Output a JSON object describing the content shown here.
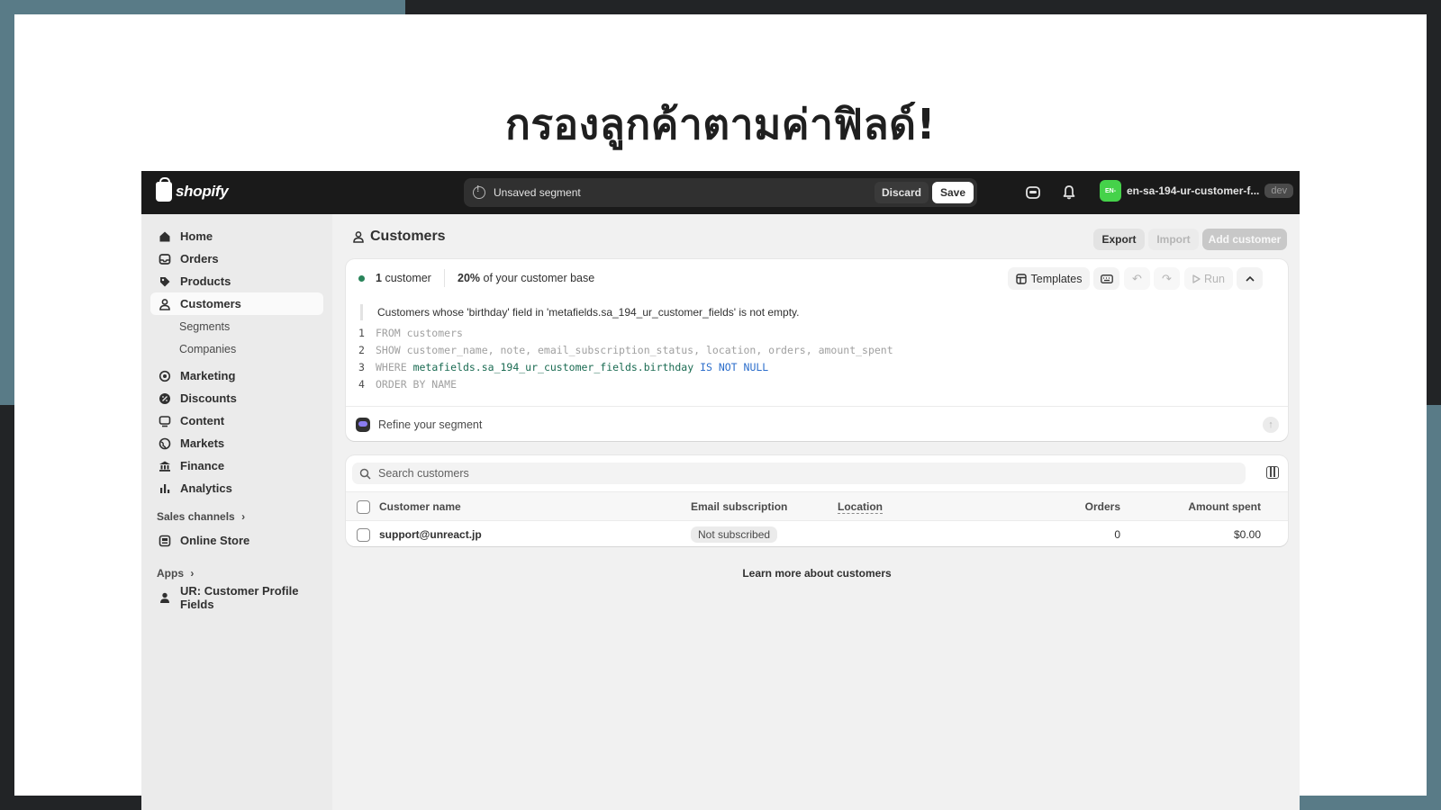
{
  "slide": {
    "title": "กรองลูกค้าตามค่าฟิลด์!"
  },
  "colors": {
    "accent_green": "#29845a",
    "store_avatar": "#45d24a",
    "topbar": "#1a1a1a"
  },
  "topbar": {
    "logo_text": "shopify",
    "unsaved_text": "Unsaved segment",
    "discard_label": "Discard",
    "save_label": "Save",
    "store_avatar_text": "EN-",
    "store_name": "en-sa-194-ur-customer-f...",
    "store_badge": "dev"
  },
  "sidebar": {
    "items": [
      {
        "label": "Home",
        "icon": "home-icon"
      },
      {
        "label": "Orders",
        "icon": "inbox-icon"
      },
      {
        "label": "Products",
        "icon": "tag-icon"
      },
      {
        "label": "Customers",
        "icon": "person-icon",
        "active": true
      },
      {
        "label": "Marketing",
        "icon": "target-icon"
      },
      {
        "label": "Discounts",
        "icon": "discount-icon"
      },
      {
        "label": "Content",
        "icon": "content-icon"
      },
      {
        "label": "Markets",
        "icon": "globe-icon"
      },
      {
        "label": "Finance",
        "icon": "bank-icon"
      },
      {
        "label": "Analytics",
        "icon": "bar-chart-icon"
      }
    ],
    "sub_items": [
      "Segments",
      "Companies"
    ],
    "sales_channels_label": "Sales channels",
    "online_store_label": "Online Store",
    "apps_label": "Apps",
    "app_item_label": "UR: Customer Profile Fields"
  },
  "header": {
    "title": "Customers",
    "export_label": "Export",
    "import_label": "Import",
    "add_customer_label": "Add customer"
  },
  "segment": {
    "count_number": "1",
    "count_label": "customer",
    "base_percent": "20%",
    "base_label": "of your customer base",
    "templates_label": "Templates",
    "run_label": "Run",
    "description": "Customers whose 'birthday' field in 'metafields.sa_194_ur_customer_fields' is not empty.",
    "code": {
      "line1_no": "1",
      "line1": "FROM customers",
      "line2_no": "2",
      "line2": "SHOW customer_name, note, email_subscription_status, location, orders, amount_spent",
      "line3_no": "3",
      "line3_kw": "WHERE",
      "line3_field": "metafields.sa_194_ur_customer_fields.birthday",
      "line3_op": "IS NOT NULL",
      "line4_no": "4",
      "line4": "ORDER BY NAME"
    },
    "refine_label": "Refine your segment"
  },
  "table": {
    "search_placeholder": "Search customers",
    "columns": [
      "Customer name",
      "Email subscription",
      "Location",
      "Orders",
      "Amount spent"
    ],
    "rows": [
      {
        "name": "support@unreact.jp",
        "email_subscription": "Not subscribed",
        "location": "",
        "orders": "0",
        "amount_spent": "$0.00"
      }
    ]
  },
  "learn_more": "Learn more about customers"
}
